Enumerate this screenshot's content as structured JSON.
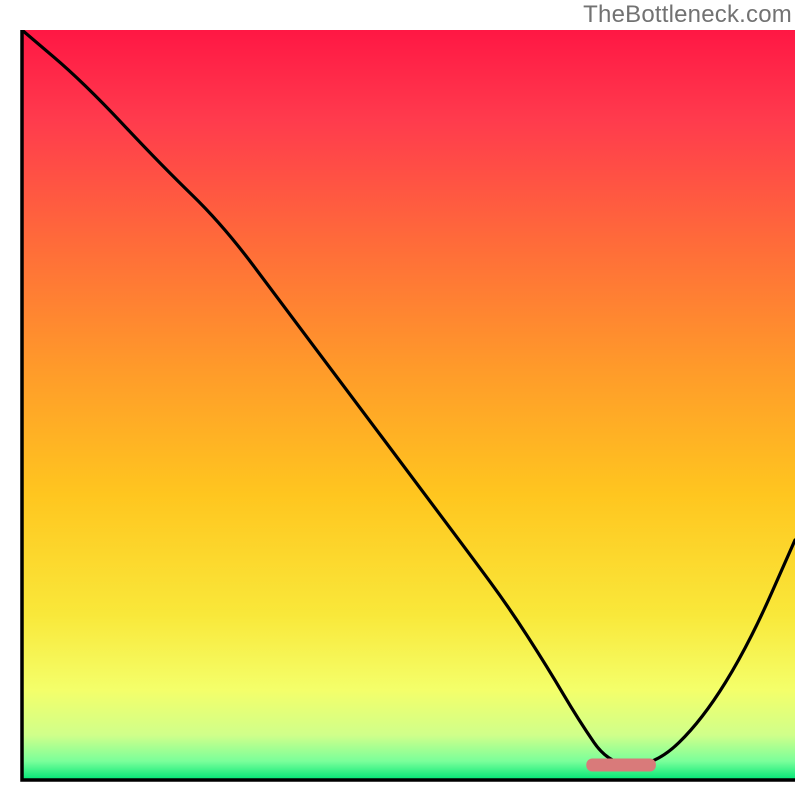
{
  "watermark": "TheBottleneck.com",
  "chart_data": {
    "type": "line",
    "title": "",
    "xlabel": "",
    "ylabel": "",
    "xlim": [
      0,
      100
    ],
    "ylim": [
      0,
      100
    ],
    "series": [
      {
        "name": "bottleneck-curve",
        "x": [
          0,
          8,
          18,
          26,
          34,
          42,
          50,
          58,
          63,
          68,
          72,
          76,
          82,
          88,
          94,
          100
        ],
        "y": [
          100,
          93,
          82,
          74,
          63,
          52,
          41,
          30,
          23,
          15,
          8,
          2,
          2,
          8,
          18,
          32
        ]
      }
    ],
    "marker": {
      "name": "optimal-range-marker",
      "x_start": 73,
      "x_end": 82,
      "y": 2,
      "color": "#d97a7a"
    },
    "gradient_stops": [
      {
        "offset": 0.0,
        "color": "#ff1744"
      },
      {
        "offset": 0.12,
        "color": "#ff3b4d"
      },
      {
        "offset": 0.28,
        "color": "#ff6a3a"
      },
      {
        "offset": 0.45,
        "color": "#ff9a2a"
      },
      {
        "offset": 0.62,
        "color": "#ffc61f"
      },
      {
        "offset": 0.78,
        "color": "#f9e83a"
      },
      {
        "offset": 0.88,
        "color": "#f4ff6a"
      },
      {
        "offset": 0.94,
        "color": "#d0ff8a"
      },
      {
        "offset": 0.975,
        "color": "#7aff9a"
      },
      {
        "offset": 1.0,
        "color": "#00e676"
      }
    ],
    "axis_color": "#000000",
    "curve_color": "#000000"
  }
}
